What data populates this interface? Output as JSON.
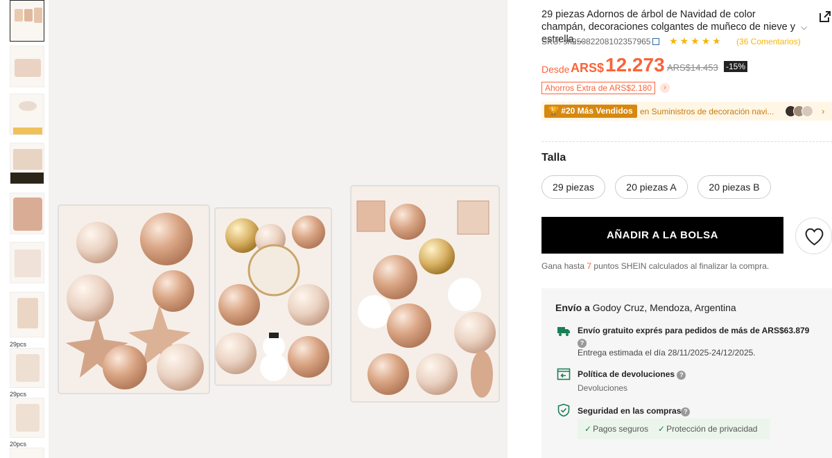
{
  "thumbnails": {
    "items": [
      {
        "label": ""
      },
      {
        "label": ""
      },
      {
        "label": ""
      },
      {
        "label": ""
      },
      {
        "label": ""
      },
      {
        "label": ""
      },
      {
        "label": ""
      },
      {
        "label": "29pcs"
      },
      {
        "label": "29pcs"
      },
      {
        "label": "20pcs"
      }
    ]
  },
  "product": {
    "title": "29 piezas Adornos de árbol de Navidad de color champán, decoraciones colgantes de muñeco de nieve y estrella,...",
    "sku": "SKU: sh25082208102357965",
    "rating": 4.5,
    "reviews": "(36 Comentarios)",
    "price_prefix": "Desde",
    "currency": "ARS$",
    "price": "12.273",
    "old_price": "ARS$14.453",
    "discount": "-15%",
    "extra_savings": "Ahorros Extra de ARS$2.180",
    "bestseller_badge": "#20 Más Vendidos",
    "bestseller_category": "en Suministros de decoración navi..."
  },
  "size": {
    "label": "Talla",
    "options": [
      "29 piezas",
      "20 piezas A",
      "20 piezas B"
    ]
  },
  "actions": {
    "add_to_bag": "AÑADIR A LA BOLSA",
    "points_prefix": "Gana hasta",
    "points_value": "7",
    "points_suffix": "puntos SHEIN calculados al finalizar la compra."
  },
  "shipping": {
    "to_label": "Envío a",
    "location": "Godoy Cruz, Mendoza, Argentina",
    "free_shipping": "Envío gratuito exprés para pedidos de más de ARS$63.879",
    "delivery_estimate": "Entrega estimada el día 28/11/2025-24/12/2025.",
    "returns_title": "Política de devoluciones",
    "returns_sub": "Devoluciones",
    "security_title": "Seguridad en las compras",
    "secure_payment": "Pagos seguros",
    "privacy": "Protección de privacidad"
  },
  "icons": {
    "share": "external-link-icon",
    "copy": "copy-icon",
    "star": "star-icon",
    "wishlist": "heart-icon",
    "truck": "truck-icon",
    "returns": "return-icon",
    "shield": "shield-check-icon"
  },
  "colors": {
    "accent": "#fa6338",
    "star": "#f5b50a",
    "shipping_green": "#198055",
    "bestseller": "#d6880f"
  }
}
